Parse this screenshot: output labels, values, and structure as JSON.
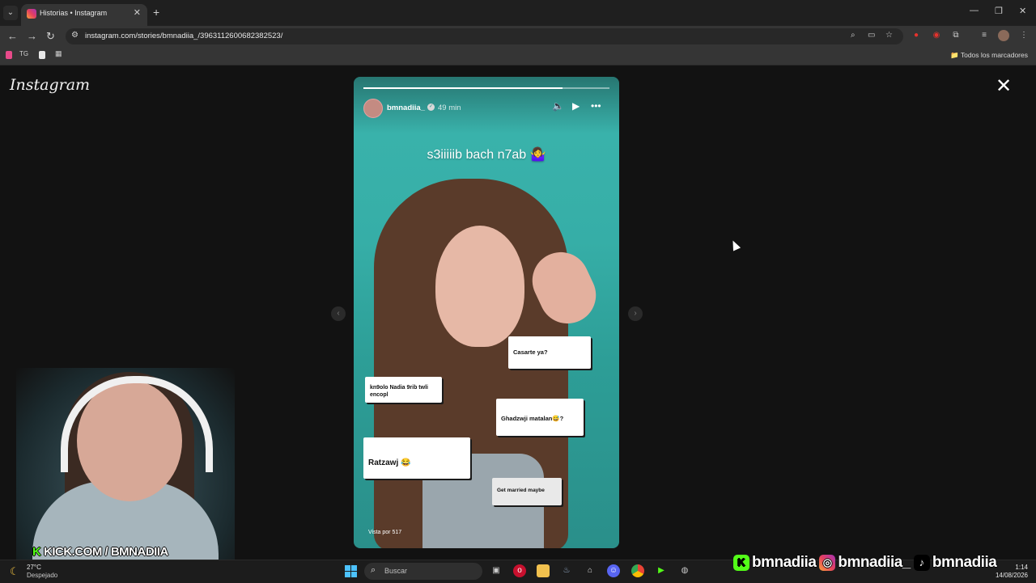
{
  "browser": {
    "tab_title": "Historias • Instagram",
    "tab_close": "✕",
    "new_tab": "+",
    "url": "instagram.com/stories/bmnadiia_/3963112600682382523/",
    "window_controls": [
      "—",
      "❐",
      "✕"
    ],
    "bookmarks": {
      "tg_label": "TG",
      "all_bookmarks": "Todos los marcadores"
    }
  },
  "instagram": {
    "logo": "Instagram",
    "close": "✕",
    "story": {
      "progress": 0.81,
      "username": "bmnadiia_",
      "time": "49 min",
      "caption": "s3iiiiib bach n7ab 🤷‍♀️",
      "views": "Vista por 517",
      "cards": [
        {
          "text": "Casarte ya?"
        },
        {
          "text": "kn9olo Nadia 9rib twli encopl"
        },
        {
          "text": "Ghadzwji matalan😅?"
        },
        {
          "text": "Ratzawj 😂"
        },
        {
          "text": "Get married maybe"
        }
      ]
    }
  },
  "overlay": {
    "kick": "KICK.COM / BMNADIIA",
    "kick_k": "K",
    "socials": [
      "bmnadiia",
      "bmnadiia_",
      "bmnadiia"
    ]
  },
  "taskbar": {
    "temp": "27°C",
    "condition": "Despejado",
    "search_placeholder": "Buscar",
    "time": "1:14",
    "date": "14/08/2026"
  },
  "colors": {
    "story_bg": "#36aea7",
    "kick_green": "#53fc18",
    "windows_blue": "#4cc2ff"
  }
}
